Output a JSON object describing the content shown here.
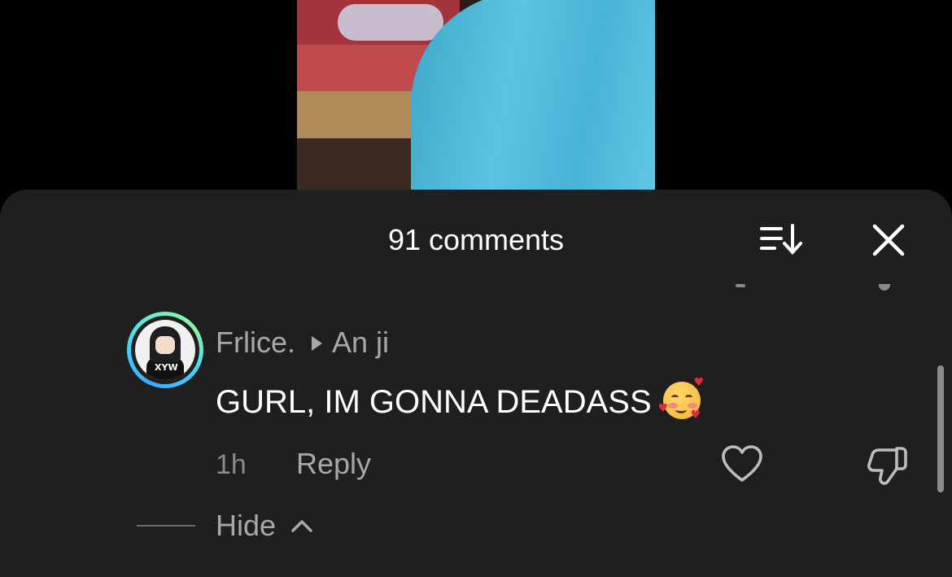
{
  "video": {
    "description_icon": "video-frame"
  },
  "sheet": {
    "title": "91 comments",
    "sort_icon": "sort-icon",
    "close_icon": "close-icon"
  },
  "comment": {
    "username": "Frlice.",
    "reply_to": "An ji",
    "text": "GURL, IM GONNA DEADASS",
    "emoji": "smiling-face-with-hearts",
    "time": "1h",
    "reply_label": "Reply",
    "like_icon": "heart-icon",
    "dislike_icon": "thumbs-down-icon"
  },
  "thread": {
    "hide_label": "Hide"
  },
  "colors": {
    "sheet_bg": "#1f1f1f",
    "text_primary": "#ffffff",
    "text_secondary": "#a8a8a8"
  }
}
